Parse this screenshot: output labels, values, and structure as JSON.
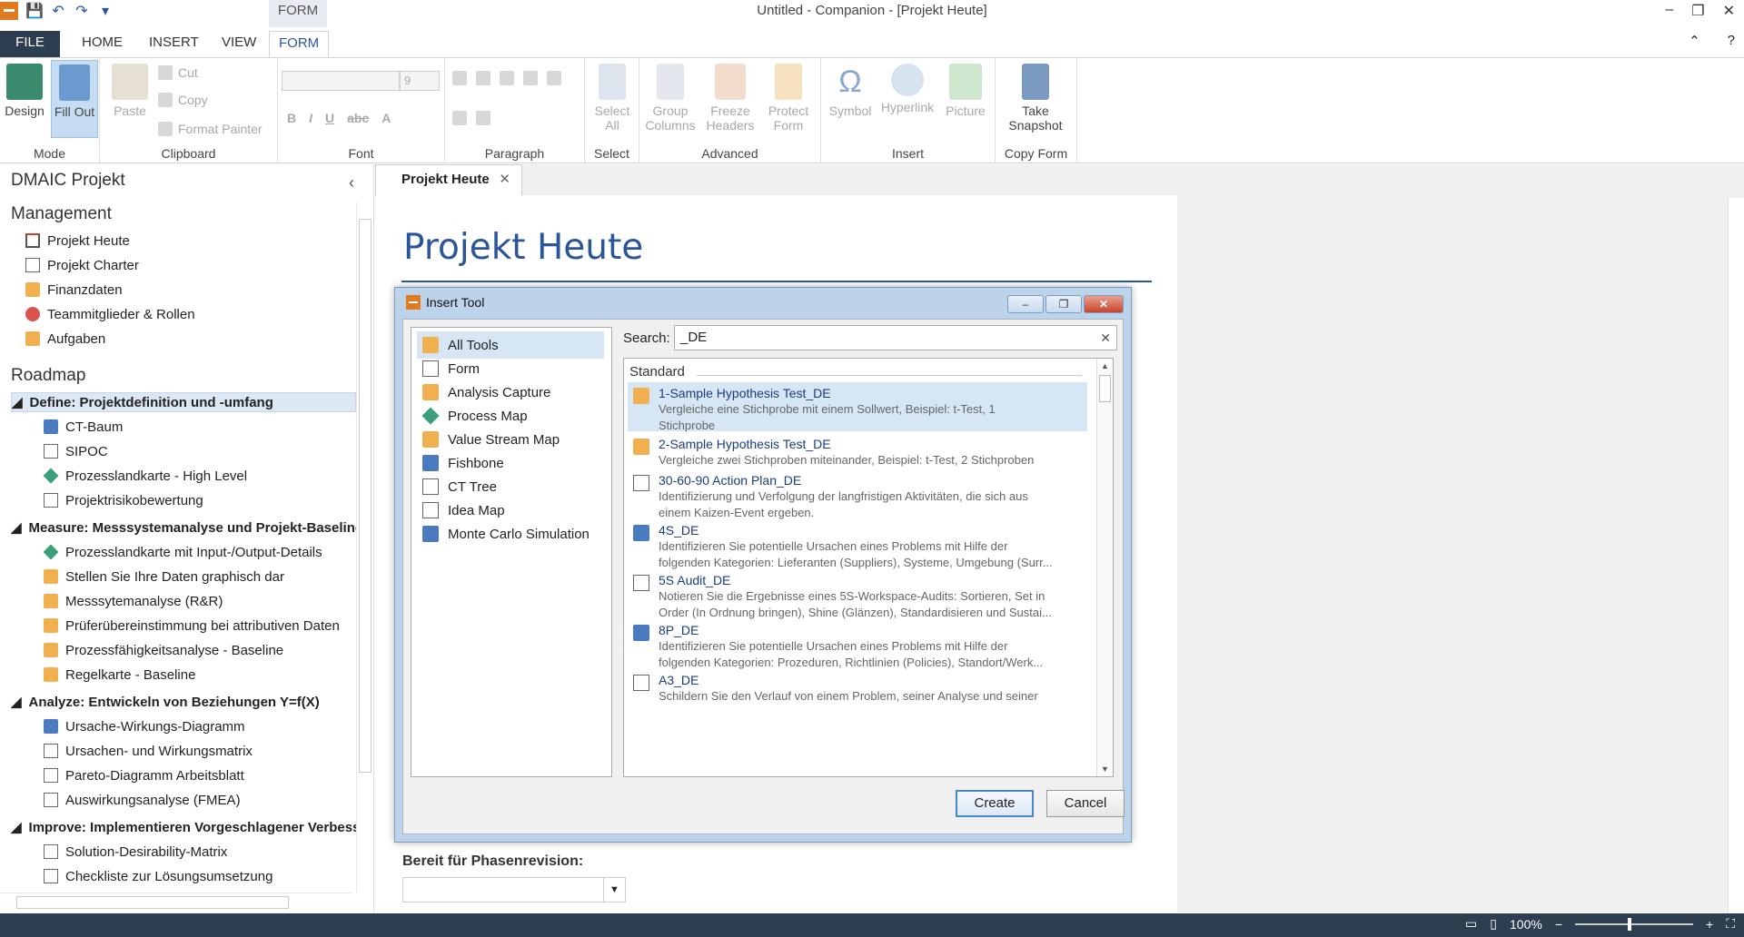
{
  "window": {
    "title": "Untitled - Companion - [Projekt Heute]",
    "context_tab": "FORM",
    "minimize": "–",
    "restore": "❐",
    "close": "✕",
    "ribbon_collapse": "⌃",
    "help": "?"
  },
  "qat": {
    "save": "💾",
    "undo": "↶",
    "redo": "↷",
    "customize": "▾"
  },
  "ribbon_tabs": [
    "FILE",
    "HOME",
    "INSERT",
    "VIEW",
    "FORM"
  ],
  "ribbon": {
    "mode": {
      "label": "Mode",
      "design": "Design",
      "fill_out": "Fill Out"
    },
    "clipboard": {
      "label": "Clipboard",
      "paste": "Paste",
      "cut": "Cut",
      "copy": "Copy",
      "format_painter": "Format Painter"
    },
    "font": {
      "label": "Font",
      "size": "9"
    },
    "paragraph": {
      "label": "Paragraph"
    },
    "select": {
      "label": "Select",
      "select_all": "Select All"
    },
    "advanced": {
      "label": "Advanced",
      "group_columns": "Group Columns",
      "freeze_headers": "Freeze Headers",
      "protect_form": "Protect Form"
    },
    "insert": {
      "label": "Insert",
      "symbol": "Symbol",
      "hyperlink": "Hyperlink",
      "picture": "Picture"
    },
    "copy_form": {
      "label": "Copy Form",
      "take_snapshot": "Take Snapshot"
    }
  },
  "nav": {
    "title": "DMAIC Projekt",
    "collapse": "‹",
    "management_header": "Management",
    "management_items": [
      "Projekt Heute",
      "Projekt Charter",
      "Finanzdaten",
      "Teammitglieder & Rollen",
      "Aufgaben"
    ],
    "roadmap_header": "Roadmap",
    "phases": [
      {
        "title": "Define:  Projektdefinition und -umfang",
        "items": [
          "CT-Baum",
          "SIPOC",
          "Prozesslandkarte - High Level",
          "Projektrisikobewertung"
        ]
      },
      {
        "title": "Measure:  Messsystemanalyse und Projekt-Baseline",
        "items": [
          "Prozesslandkarte mit Input-/Output-Details",
          "Stellen Sie Ihre Daten graphisch dar",
          "Messsytemanalyse (R&R)",
          "Prüferübereinstimmung bei attributiven Daten",
          "Prozessfähigkeitsanalyse - Baseline",
          "Regelkarte - Baseline"
        ]
      },
      {
        "title": "Analyze:  Entwickeln von Beziehungen Y=f(X)",
        "items": [
          "Ursache-Wirkungs-Diagramm",
          "Ursachen- und Wirkungsmatrix",
          "Pareto-Diagramm Arbeitsblatt",
          "Auswirkungsanalyse (FMEA)"
        ]
      },
      {
        "title": "Improve:  Implementieren Vorgeschlagener Verbesserungen",
        "items": [
          "Solution-Desirability-Matrix",
          "Checkliste zur Lösungsumsetzung"
        ]
      }
    ]
  },
  "doc": {
    "tab_label": "Projekt Heute",
    "tab_close": "✕",
    "heading": "Projekt Heute",
    "field_label": "Bereit für Phasenrevision:",
    "field_value": ""
  },
  "dialog": {
    "title": "Insert Tool",
    "categories": [
      "All Tools",
      "Form",
      "Analysis Capture",
      "Process Map",
      "Value Stream Map",
      "Fishbone",
      "CT Tree",
      "Idea Map",
      "Monte Carlo Simulation"
    ],
    "search_label": "Search:",
    "search_value": "_DE",
    "results_header": "Standard",
    "results": [
      {
        "name": "1-Sample Hypothesis Test_DE",
        "desc1": "Vergleiche eine Stichprobe mit einem Sollwert, Beispiel: t-Test, 1",
        "desc2": "Stichprobe"
      },
      {
        "name": "2-Sample Hypothesis Test_DE",
        "desc1": "Vergleiche zwei Stichproben miteinander, Beispiel: t-Test, 2 Stichproben",
        "desc2": ""
      },
      {
        "name": "30-60-90 Action Plan_DE",
        "desc1": "Identifizierung und Verfolgung der langfristigen Aktivitäten, die sich aus",
        "desc2": "einem Kaizen-Event ergeben."
      },
      {
        "name": "4S_DE",
        "desc1": "Identifizieren Sie potentielle Ursachen eines Problems mit Hilfe der",
        "desc2": "folgenden Kategorien: Lieferanten (Suppliers), Systeme, Umgebung (Surr..."
      },
      {
        "name": "5S Audit_DE",
        "desc1": "Notieren Sie die Ergebnisse eines 5S-Workspace-Audits: Sortieren, Set in",
        "desc2": "Order (In Ordnung bringen), Shine (Glänzen), Standardisieren und Sustai..."
      },
      {
        "name": "8P_DE",
        "desc1": "Identifizieren Sie potentielle Ursachen eines Problems mit Hilfe der",
        "desc2": "folgenden Kategorien: Prozeduren, Richtlinien (Policies), Standort/Werk..."
      },
      {
        "name": "A3_DE",
        "desc1": "Schildern Sie den Verlauf von einem Problem, seiner Analyse und seiner",
        "desc2": ""
      }
    ],
    "create": "Create",
    "cancel": "Cancel"
  },
  "status": {
    "zoom": "100%"
  }
}
